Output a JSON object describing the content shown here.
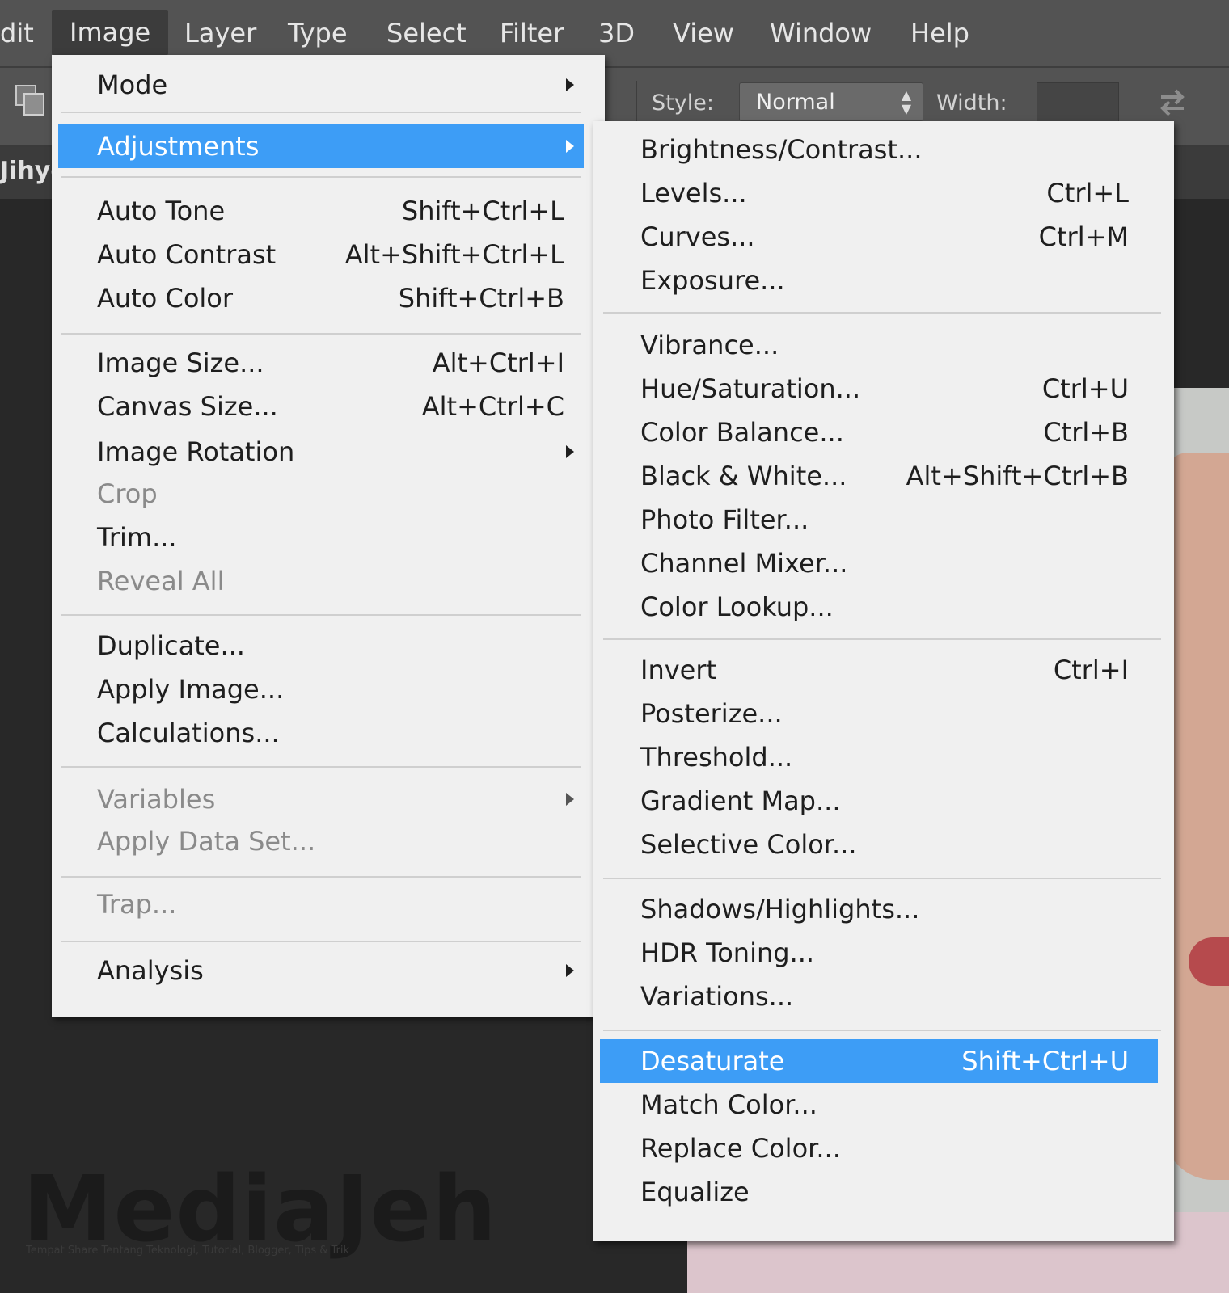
{
  "menubar": {
    "items": [
      "dit",
      "Image",
      "Layer",
      "Type",
      "Select",
      "Filter",
      "3D",
      "View",
      "Window",
      "Help"
    ],
    "active": "Image"
  },
  "options_bar": {
    "style_label": "Style:",
    "style_value": "Normal",
    "width_label": "Width:",
    "width_value": ""
  },
  "document_tab": {
    "label": "Jihye"
  },
  "image_menu": {
    "items": [
      {
        "label": "Mode",
        "submenu": true
      },
      {
        "label": "Adjustments",
        "submenu": true,
        "highlighted": true
      },
      {
        "label": "Auto Tone",
        "shortcut": "Shift+Ctrl+L"
      },
      {
        "label": "Auto Contrast",
        "shortcut": "Alt+Shift+Ctrl+L"
      },
      {
        "label": "Auto Color",
        "shortcut": "Shift+Ctrl+B"
      },
      {
        "label": "Image Size...",
        "shortcut": "Alt+Ctrl+I"
      },
      {
        "label": "Canvas Size...",
        "shortcut": "Alt+Ctrl+C"
      },
      {
        "label": "Image Rotation",
        "submenu": true
      },
      {
        "label": "Crop",
        "disabled": true
      },
      {
        "label": "Trim..."
      },
      {
        "label": "Reveal All",
        "disabled": true
      },
      {
        "label": "Duplicate..."
      },
      {
        "label": "Apply Image..."
      },
      {
        "label": "Calculations..."
      },
      {
        "label": "Variables",
        "submenu": true,
        "disabled": true
      },
      {
        "label": "Apply Data Set...",
        "disabled": true
      },
      {
        "label": "Trap...",
        "disabled": true
      },
      {
        "label": "Analysis",
        "submenu": true
      }
    ]
  },
  "adjustments_menu": {
    "items": [
      {
        "label": "Brightness/Contrast...",
        "shortcut": ""
      },
      {
        "label": "Levels...",
        "shortcut": "Ctrl+L"
      },
      {
        "label": "Curves...",
        "shortcut": "Ctrl+M"
      },
      {
        "label": "Exposure...",
        "shortcut": ""
      },
      {
        "label": "Vibrance...",
        "shortcut": ""
      },
      {
        "label": "Hue/Saturation...",
        "shortcut": "Ctrl+U"
      },
      {
        "label": "Color Balance...",
        "shortcut": "Ctrl+B"
      },
      {
        "label": "Black & White...",
        "shortcut": "Alt+Shift+Ctrl+B"
      },
      {
        "label": "Photo Filter...",
        "shortcut": ""
      },
      {
        "label": "Channel Mixer...",
        "shortcut": ""
      },
      {
        "label": "Color Lookup...",
        "shortcut": ""
      },
      {
        "label": "Invert",
        "shortcut": "Ctrl+I"
      },
      {
        "label": "Posterize...",
        "shortcut": ""
      },
      {
        "label": "Threshold...",
        "shortcut": ""
      },
      {
        "label": "Gradient Map...",
        "shortcut": ""
      },
      {
        "label": "Selective Color...",
        "shortcut": ""
      },
      {
        "label": "Shadows/Highlights...",
        "shortcut": ""
      },
      {
        "label": "HDR Toning...",
        "shortcut": ""
      },
      {
        "label": "Variations...",
        "shortcut": ""
      },
      {
        "label": "Desaturate",
        "shortcut": "Shift+Ctrl+U",
        "highlighted": true
      },
      {
        "label": "Match Color...",
        "shortcut": ""
      },
      {
        "label": "Replace Color...",
        "shortcut": ""
      },
      {
        "label": "Equalize",
        "shortcut": ""
      }
    ]
  },
  "watermark": {
    "logo": "MediaJeh",
    "tagline": "Tempat Share Tentang Teknologi, Tutorial, Blogger, Tips & Trik"
  },
  "colors": {
    "highlight": "#3d9df6",
    "menu_bg": "#f0f0f0",
    "menubar_bg": "#535353",
    "disabled_text": "#8a8a8a"
  }
}
